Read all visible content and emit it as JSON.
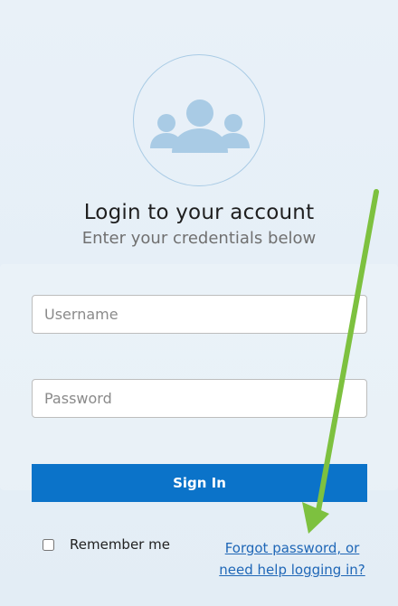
{
  "login": {
    "title": "Login to your account",
    "subtitle": "Enter your credentials below"
  },
  "fields": {
    "username_placeholder": "Username",
    "username_value": "",
    "password_placeholder": "Password",
    "password_value": ""
  },
  "actions": {
    "sign_in_label": "Sign In",
    "remember_label": "Remember me",
    "remember_checked": false,
    "forgot_line1": "Forgot password, or",
    "forgot_line2": "need help logging in?"
  },
  "icons": {
    "avatar": "users-group-icon",
    "annotation": "arrow-annotation-icon"
  },
  "colors": {
    "primary": "#0b73c9",
    "link": "#1f67b7",
    "avatar_icon": "#a9cbe5",
    "annotation": "#7dc13f"
  }
}
